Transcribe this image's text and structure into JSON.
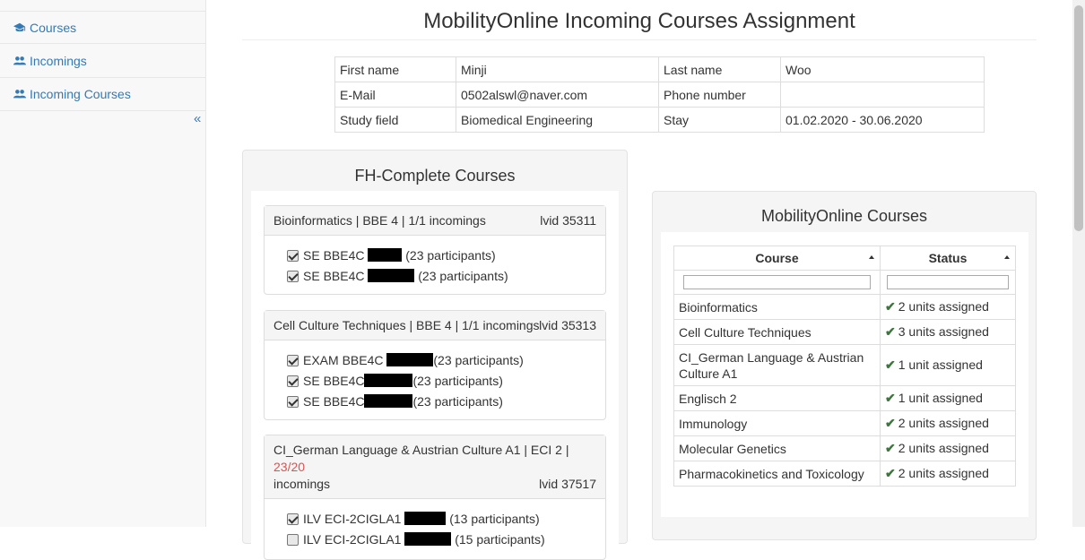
{
  "sidebar": {
    "items": [
      {
        "label": "Courses",
        "icon": "graduation-cap-icon"
      },
      {
        "label": "Incomings",
        "icon": "users-icon"
      },
      {
        "label": "Incoming Courses",
        "icon": "users-icon"
      }
    ],
    "collapse_label": "«"
  },
  "page": {
    "title": "MobilityOnline Incoming Courses Assignment"
  },
  "student": {
    "first_name_label": "First name",
    "first_name": "Minji",
    "last_name_label": "Last name",
    "last_name": "Woo",
    "email_label": "E-Mail",
    "email": "0502alswl@naver.com",
    "phone_label": "Phone number",
    "phone": "",
    "study_field_label": "Study field",
    "study_field": "Biomedical Engineering",
    "stay_label": "Stay",
    "stay": "01.02.2020 - 30.06.2020"
  },
  "fh_courses": {
    "title": "FH-Complete Courses",
    "groups": [
      {
        "name": "Bioinformatics | BBE 4 | 1/1 incomings",
        "lvid": "lvid 35311",
        "entries": [
          {
            "code": "SE BBE4C",
            "participants": "(23 participants)",
            "checked": true
          },
          {
            "code": "SE BBE4C",
            "participants": "(23 participants)",
            "checked": true
          }
        ]
      },
      {
        "name": "Cell Culture Techniques | BBE 4 | 1/1 incomings",
        "lvid": "lvid 35313",
        "entries": [
          {
            "code": "EXAM BBE4C",
            "participants": "(23 participants)",
            "checked": true
          },
          {
            "code": "SE BBE4C",
            "participants": "(23 participants)",
            "checked": true
          },
          {
            "code": "SE BBE4C",
            "participants": "(23 participants)",
            "checked": true
          }
        ]
      },
      {
        "name": "CI_German Language & Austrian Culture A1 | ECI 2 |",
        "count": "23/20",
        "suffix": "incomings",
        "lvid": "lvid 37517",
        "entries": [
          {
            "code": "ILV ECI-2CIGLA1",
            "participants": "(13 participants)",
            "checked": true
          },
          {
            "code": "ILV ECI-2CIGLA1",
            "participants": "(15 participants)",
            "checked": false
          }
        ]
      }
    ]
  },
  "mo_courses": {
    "title": "MobilityOnline Courses",
    "columns": [
      "Course",
      "Status"
    ],
    "rows": [
      {
        "course": "Bioinformatics",
        "status": "2 units assigned"
      },
      {
        "course": "Cell Culture Techniques",
        "status": "3 units assigned"
      },
      {
        "course": "CI_German Language & Austrian Culture A1",
        "status": "1 unit assigned"
      },
      {
        "course": "Englisch 2",
        "status": "1 unit assigned"
      },
      {
        "course": "Immunology",
        "status": "2 units assigned"
      },
      {
        "course": "Molecular Genetics",
        "status": "2 units assigned"
      },
      {
        "course": "Pharmacokinetics and Toxicology",
        "status": "2 units assigned"
      }
    ]
  }
}
